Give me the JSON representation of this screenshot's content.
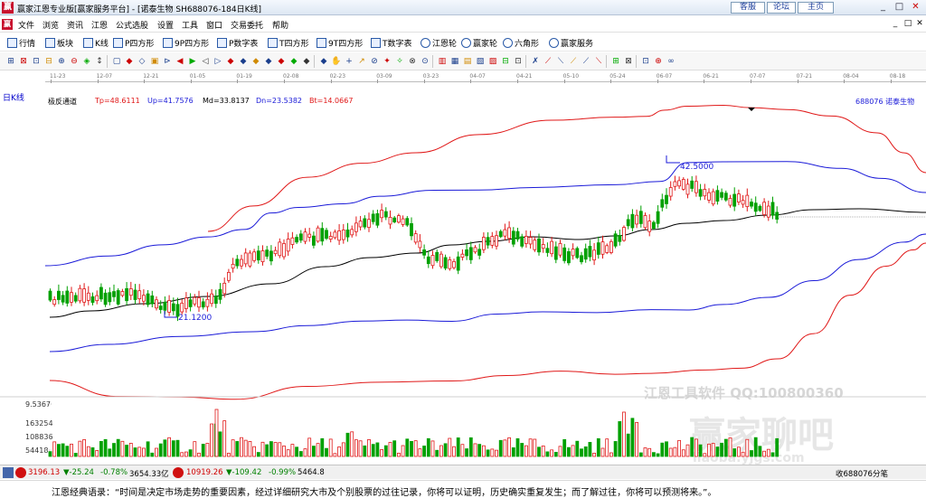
{
  "window": {
    "title": "赢家江恩专业版[赢家服务平台] - [诺泰生物  SH688076-184日K线]",
    "logo": "赢",
    "links": [
      "客服",
      "论坛",
      "主页"
    ],
    "controls": [
      "_",
      "□",
      "✕"
    ]
  },
  "menu": {
    "logo": "赢",
    "items": [
      "文件",
      "浏览",
      "资讯",
      "江恩",
      "公式选股",
      "设置",
      "工具",
      "窗口",
      "交易委托",
      "帮助"
    ],
    "mdi_controls": [
      "_",
      "□",
      "✕"
    ]
  },
  "toolbar1": {
    "items": [
      {
        "icon": "grid-icon",
        "label": "行情"
      },
      {
        "icon": "blocks-icon",
        "label": "板块"
      },
      {
        "icon": "candle-icon",
        "label": "K线"
      },
      {
        "icon": "p-square-icon",
        "label": "P四方形"
      },
      {
        "icon": "9p-square-icon",
        "label": "9P四方形"
      },
      {
        "icon": "p-table-icon",
        "label": "P数字表"
      },
      {
        "icon": "t-square-icon",
        "label": "T四方形"
      },
      {
        "icon": "9t-square-icon",
        "label": "9T四方形"
      },
      {
        "icon": "t-table-icon",
        "label": "T数字表"
      },
      {
        "icon": "gann-wheel-icon",
        "label": "江恩轮"
      },
      {
        "icon": "winner-wheel-icon",
        "label": "赢家轮"
      },
      {
        "icon": "hexagon-icon",
        "label": "六角形"
      },
      {
        "icon": "service-icon",
        "label": "赢家服务"
      }
    ]
  },
  "toolbar2": {
    "icons": [
      "⊞",
      "⊠",
      "⊡",
      "⊟",
      "⊕",
      "⊖",
      "◈",
      "↕",
      "▢",
      "◆",
      "◇",
      "▣",
      "⊳",
      "◀",
      "▶",
      "◁",
      "▷",
      "◆",
      "◆",
      "◆",
      "◆",
      "◆",
      "◆",
      "◆",
      "◆",
      "✋",
      "+",
      "↗",
      "⊘",
      "✦",
      "✧",
      "⊗",
      "⊙",
      "▥",
      "▦",
      "▤",
      "▧",
      "▨",
      "⊟",
      "⊡",
      "✗",
      "⟋",
      "⟍",
      "⟋",
      "⟋",
      "⟍",
      "⊞",
      "⊠",
      "⊡",
      "⊕",
      "∞"
    ]
  },
  "period_label": "日K线",
  "date_ticks": [
    "11-23",
    "12-07",
    "12-21",
    "01-05",
    "01-19",
    "02-08",
    "02-23",
    "03-09",
    "03-23",
    "04-07",
    "04-21",
    "05-10",
    "05-24",
    "06-07",
    "06-21",
    "07-07",
    "07-21",
    "08-04",
    "08-18"
  ],
  "indicator": {
    "name": "极反通道",
    "tp": "Tp=48.6111",
    "up": "Up=41.7576",
    "md": "Md=33.8137",
    "dn": "Dn=23.5382",
    "bt": "Bt=14.0667",
    "stock": "688076  诺泰生物"
  },
  "annotations": {
    "high": "42.5000",
    "low": "21.1200"
  },
  "volume_axis": [
    "9.5367",
    "163254",
    "108836",
    "54418"
  ],
  "watermark": {
    "line1": "江恩工具软件  QQ:100800360",
    "line2": "赢家聊吧",
    "line3": "liaoba.yjgs.com"
  },
  "statusbar": {
    "sh": "3196.13",
    "sh_change": "▼-25.24",
    "sh_pct": "-0.78%",
    "sh_amount": "3654.33亿",
    "sz": "10919.26",
    "sz_change": "▼-109.42",
    "sz_pct": "-0.99%",
    "sz_amount": "5464.8",
    "right": "收688076分笔"
  },
  "quote": "江恩经典语录：“时间是决定市场走势的重要因素，经过详细研究大市及个别股票的过往记录，你将可以证明，历史确实重复发生；而了解过往，你将可以预测将来。”。",
  "colors": {
    "tp_line": "#e01818",
    "up_line": "#1a1ad8",
    "md_line": "#000000",
    "candle_up": "#e01818",
    "candle_down": "#00a000",
    "text_up": "#d00000",
    "text_down": "#008000"
  }
}
